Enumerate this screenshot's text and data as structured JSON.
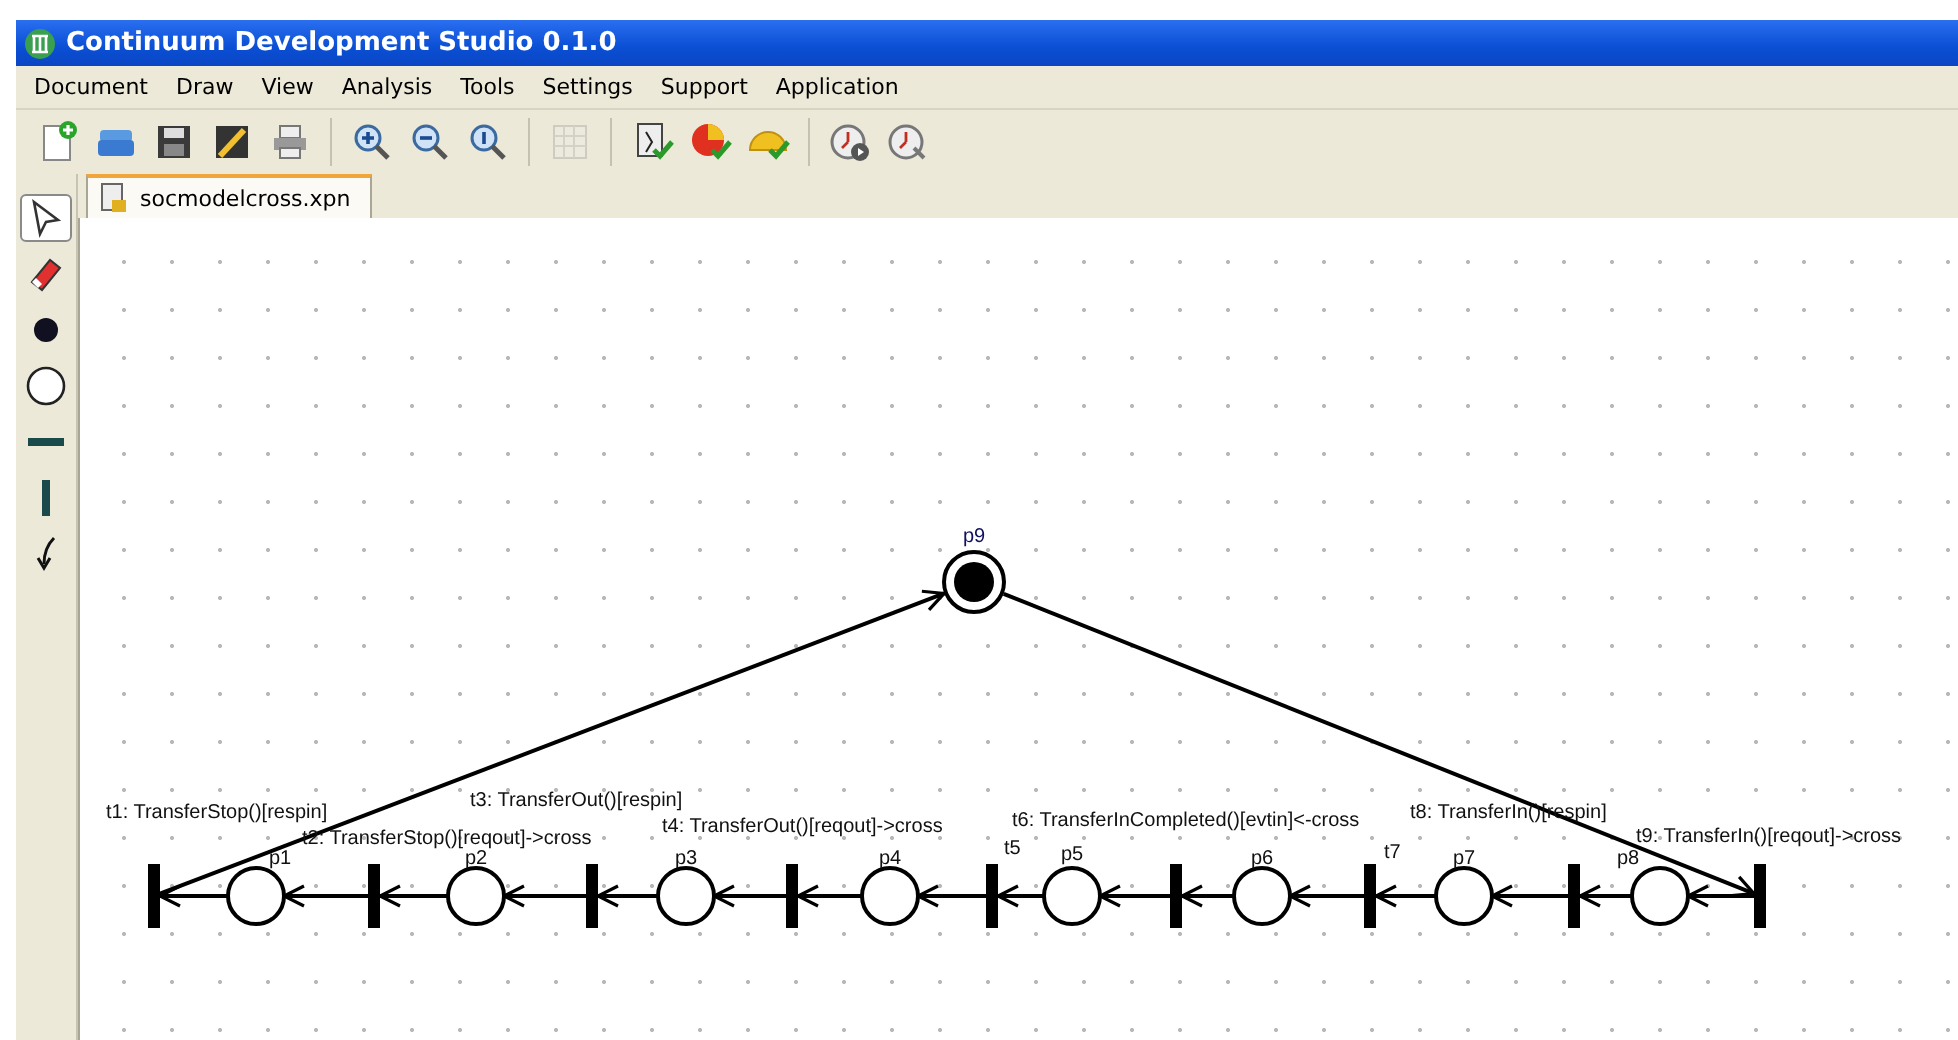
{
  "window": {
    "title": "Continuum Development Studio 0.1.0"
  },
  "menu": [
    "Document",
    "Draw",
    "View",
    "Analysis",
    "Tools",
    "Settings",
    "Support",
    "Application"
  ],
  "toolbar": [
    [
      {
        "kind": "new",
        "disabled": false
      },
      {
        "kind": "open",
        "disabled": false
      },
      {
        "kind": "save",
        "disabled": false
      },
      {
        "kind": "edit",
        "disabled": false
      },
      {
        "kind": "print",
        "disabled": false
      }
    ],
    [
      {
        "kind": "zoom-in",
        "disabled": false
      },
      {
        "kind": "zoom-out",
        "disabled": false
      },
      {
        "kind": "zoom-reset",
        "disabled": false
      }
    ],
    [
      {
        "kind": "grid",
        "disabled": true
      }
    ],
    [
      {
        "kind": "check-model",
        "disabled": false
      },
      {
        "kind": "check-ball",
        "disabled": false
      },
      {
        "kind": "check-helmet",
        "disabled": false
      }
    ],
    [
      {
        "kind": "clock-play",
        "disabled": false
      },
      {
        "kind": "clock-search",
        "disabled": false
      }
    ]
  ],
  "palette": [
    {
      "kind": "pointer",
      "selected": true
    },
    {
      "kind": "eraser",
      "selected": false
    },
    {
      "kind": "token",
      "selected": false
    },
    {
      "kind": "place",
      "selected": false
    },
    {
      "kind": "h-transition",
      "selected": false
    },
    {
      "kind": "v-transition",
      "selected": false
    },
    {
      "kind": "arc",
      "selected": false
    }
  ],
  "tabs": [
    {
      "label": "socmodelcross.xpn",
      "selected": true
    }
  ],
  "net": {
    "places": [
      {
        "label": "p1",
        "marked": false
      },
      {
        "label": "p2",
        "marked": false
      },
      {
        "label": "p3",
        "marked": false
      },
      {
        "label": "p4",
        "marked": false
      },
      {
        "label": "p5",
        "marked": false
      },
      {
        "label": "p6",
        "marked": false
      },
      {
        "label": "p7",
        "marked": false
      },
      {
        "label": "p8",
        "marked": false
      },
      {
        "label": "p9",
        "marked": true
      }
    ],
    "transitions": [
      {
        "label": "t1: TransferStop()[respin]"
      },
      {
        "label": "t2: TransferStop()[reqout]->cross"
      },
      {
        "label": "t3: TransferOut()[respin]"
      },
      {
        "label": "t4: TransferOut()[reqout]->cross"
      },
      {
        "label": "t5"
      },
      {
        "label": "t6: TransferInCompleted()[evtin]<-cross"
      },
      {
        "label": "t7"
      },
      {
        "label": "t8: TransferIn()[respin]"
      },
      {
        "label": "t9: TransferIn()[reqout]->cross"
      }
    ]
  }
}
